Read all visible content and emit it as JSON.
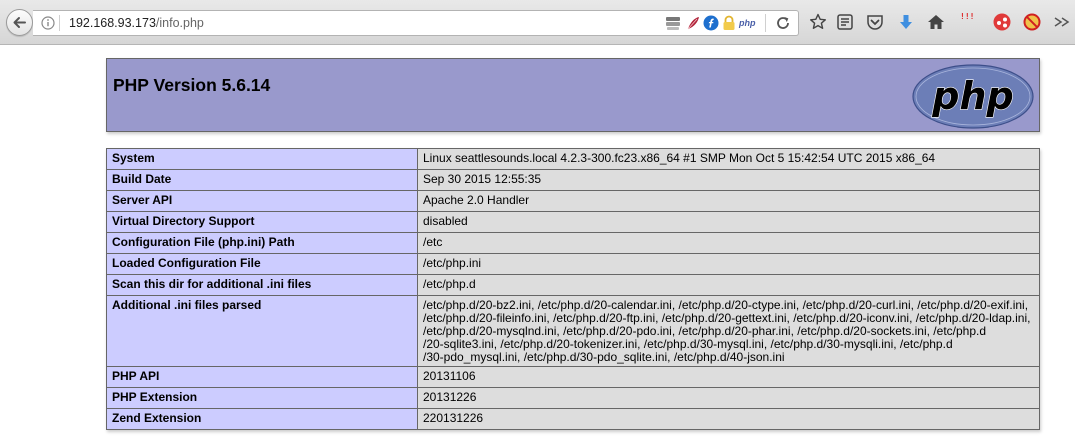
{
  "browser": {
    "url_host": "192.168.93.173",
    "url_path": "/info.php",
    "ext_badge": "php",
    "addon_badge": "!!!"
  },
  "page": {
    "title": "PHP Version 5.6.14",
    "logo_text": "php"
  },
  "rows": [
    {
      "key": "System",
      "value": "Linux seattlesounds.local 4.2.3-300.fc23.x86_64 #1 SMP Mon Oct 5 15:42:54 UTC 2015 x86_64"
    },
    {
      "key": "Build Date",
      "value": "Sep 30 2015 12:55:35"
    },
    {
      "key": "Server API",
      "value": "Apache 2.0 Handler"
    },
    {
      "key": "Virtual Directory Support",
      "value": "disabled"
    },
    {
      "key": "Configuration File (php.ini) Path",
      "value": "/etc"
    },
    {
      "key": "Loaded Configuration File",
      "value": "/etc/php.ini"
    },
    {
      "key": "Scan this dir for additional .ini files",
      "value": "/etc/php.d"
    },
    {
      "key": "Additional .ini files parsed",
      "lines": [
        "/etc/php.d/20-bz2.ini, /etc/php.d/20-calendar.ini, /etc/php.d/20-ctype.ini, /etc/php.d/20-curl.ini, /etc/php.d/20-exif.ini,",
        "/etc/php.d/20-fileinfo.ini, /etc/php.d/20-ftp.ini, /etc/php.d/20-gettext.ini, /etc/php.d/20-iconv.ini, /etc/php.d/20-ldap.ini,",
        "/etc/php.d/20-mysqlnd.ini, /etc/php.d/20-pdo.ini, /etc/php.d/20-phar.ini, /etc/php.d/20-sockets.ini, /etc/php.d",
        "/20-sqlite3.ini, /etc/php.d/20-tokenizer.ini, /etc/php.d/30-mysql.ini, /etc/php.d/30-mysqli.ini, /etc/php.d",
        "/30-pdo_mysql.ini, /etc/php.d/30-pdo_sqlite.ini, /etc/php.d/40-json.ini"
      ]
    },
    {
      "key": "PHP API",
      "value": "20131106"
    },
    {
      "key": "PHP Extension",
      "value": "20131226"
    },
    {
      "key": "Zend Extension",
      "value": "220131226"
    }
  ],
  "colors": {
    "header_bg": "#9999cc",
    "key_cell_bg": "#ccccff",
    "value_cell_bg": "#dddddd",
    "logo_bg": "#6c7eb7"
  }
}
